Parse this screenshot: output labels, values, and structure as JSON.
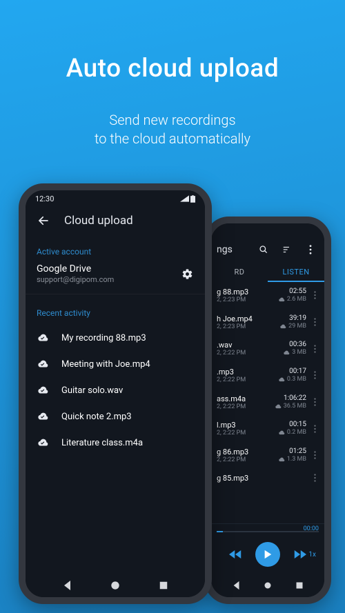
{
  "hero": {
    "title": "Auto cloud upload",
    "sub_line1": "Send new recordings",
    "sub_line2": "to the cloud automatically"
  },
  "front": {
    "status_time": "12:30",
    "app_title": "Cloud upload",
    "active_account_label": "Active account",
    "account_name": "Google Drive",
    "account_email": "support@digipom.com",
    "recent_label": "Recent activity",
    "files": [
      {
        "name": "My recording 88.mp3"
      },
      {
        "name": "Meeting with Joe.mp4"
      },
      {
        "name": "Guitar solo.wav"
      },
      {
        "name": "Quick note 2.mp3"
      },
      {
        "name": "Literature class.m4a"
      }
    ]
  },
  "back": {
    "app_title": "ngs",
    "tabs": {
      "record": "RD",
      "listen": "LISTEN"
    },
    "rows": [
      {
        "title": "g 88.mp3",
        "sub": "2, 2:23 PM",
        "dur": "02:55",
        "size": "2.6 MB",
        "cloud": true
      },
      {
        "title": "h Joe.mp4",
        "sub": "2, 2:23 PM",
        "dur": "39:19",
        "size": "29 MB",
        "cloud": true
      },
      {
        "title": ".wav",
        "sub": "2, 2:22 PM",
        "dur": "00:36",
        "size": "3 MB",
        "cloud": true
      },
      {
        "title": ".mp3",
        "sub": "2, 2:22 PM",
        "dur": "00:17",
        "size": "0.3 MB",
        "cloud": true
      },
      {
        "title": "ass.m4a",
        "sub": "2, 2:22 PM",
        "dur": "1:06:22",
        "size": "36.5 MB",
        "cloud": true
      },
      {
        "title": "l.mp3",
        "sub": "2, 2:22 PM",
        "dur": "00:15",
        "size": "0.2 MB",
        "cloud": true
      },
      {
        "title": "g 86.mp3",
        "sub": "2, 2:22 PM",
        "dur": "01:25",
        "size": "1.3 MB",
        "cloud": true
      },
      {
        "title": "g 85.mp3",
        "sub": "",
        "dur": "",
        "size": "",
        "cloud": false
      }
    ],
    "seek_time": "00:00",
    "rate": "1x"
  },
  "colors": {
    "accent": "#2f9be6"
  }
}
